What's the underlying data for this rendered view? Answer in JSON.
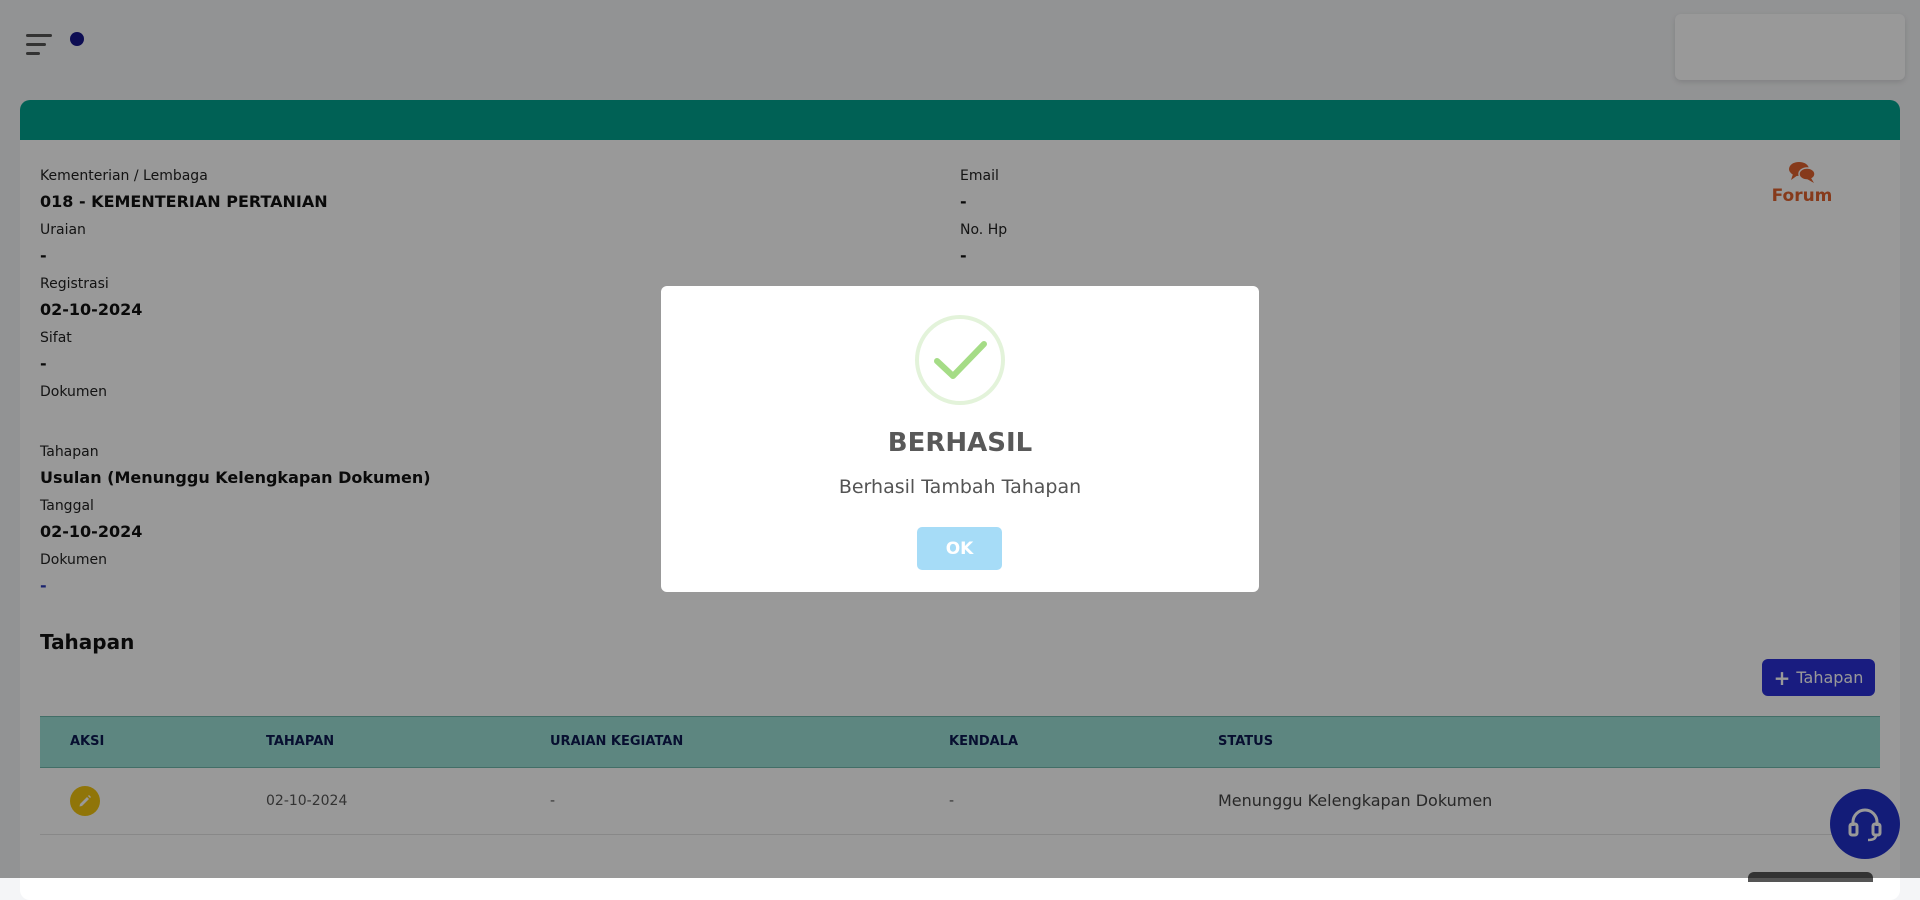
{
  "details_left": [
    {
      "label": "Kementerian / Lembaga",
      "value": "018 - KEMENTERIAN PERTANIAN"
    },
    {
      "label": "Uraian",
      "value": "-"
    },
    {
      "label": "Registrasi",
      "value": "02-10-2024"
    },
    {
      "label": "Sifat",
      "value": "-"
    },
    {
      "label": "Dokumen",
      "value": ""
    },
    {
      "label": "Tahapan",
      "value": "Usulan (Menunggu Kelengkapan Dokumen)"
    },
    {
      "label": "Tanggal",
      "value": "02-10-2024"
    },
    {
      "label": "Dokumen",
      "value": "-"
    }
  ],
  "details_right": [
    {
      "label": "Email",
      "value": "-"
    },
    {
      "label": "No. Hp",
      "value": "-"
    }
  ],
  "forum": {
    "label": "Forum"
  },
  "section": {
    "title": "Tahapan",
    "add_button": "Tahapan"
  },
  "table": {
    "columns": [
      "AKSI",
      "TAHAPAN",
      "URAIAN KEGIATAN",
      "KENDALA",
      "STATUS"
    ],
    "rows": [
      {
        "tahapan": "02-10-2024",
        "uraian": "-",
        "kendala": "-",
        "status": "Menunggu Kelengkapan Dokumen"
      }
    ]
  },
  "modal": {
    "title": "BERHASIL",
    "message": "Berhasil Tambah Tahapan",
    "ok_label": "OK"
  },
  "icons": {
    "menu": "hamburger-menu-icon",
    "forum": "chat-bubbles-icon",
    "edit": "pencil-icon",
    "add": "plus-icon",
    "help": "headset-icon",
    "success": "check-circle-icon"
  },
  "colors": {
    "header_accent": "#00a28e",
    "primary_button": "#2a2fd6",
    "forum": "#e0612d",
    "table_header": "#9ce0d5",
    "edit_button": "#f1c40f",
    "success": "#a5dc86",
    "ok_button": "#a6dcf7"
  }
}
